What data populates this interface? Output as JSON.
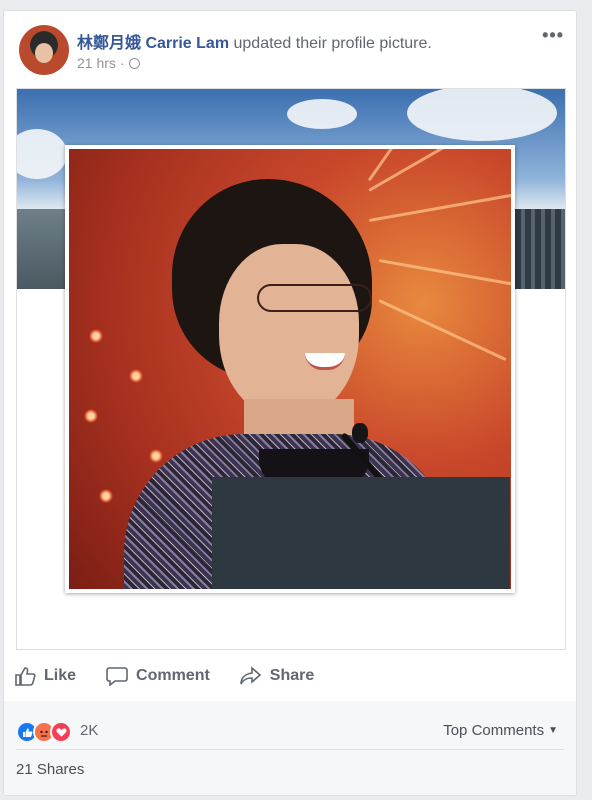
{
  "post": {
    "author_name": "林鄭月娥 Carrie Lam",
    "action_text": " updated their profile picture.",
    "timestamp": "21 hrs",
    "separator": "·",
    "more_label": "•••"
  },
  "actions": {
    "like_label": "Like",
    "comment_label": "Comment",
    "share_label": "Share"
  },
  "reactions": {
    "icons": [
      "like-reaction",
      "angry-reaction",
      "love-reaction"
    ],
    "count": "2K",
    "top_comments_label": "Top Comments",
    "shares_label": "21 Shares"
  },
  "colors": {
    "author_link": "#365899",
    "like_blue": "#1877f2",
    "love_red": "#f33e58",
    "angry_orange": "#f7714b"
  }
}
